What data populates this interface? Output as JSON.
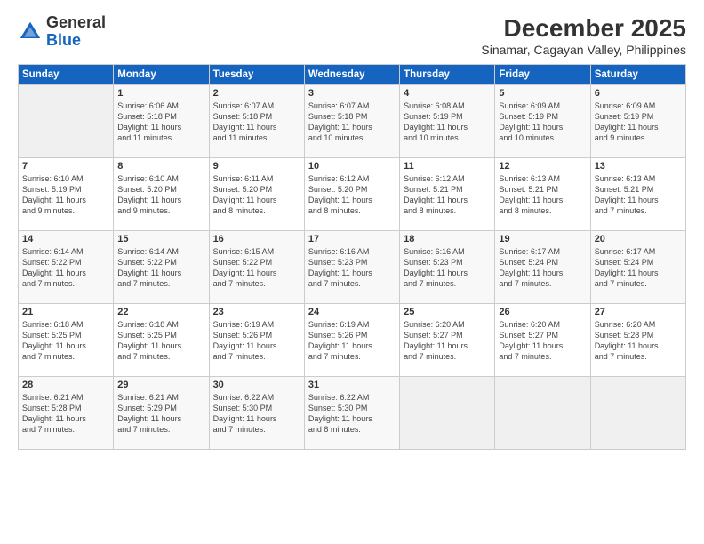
{
  "logo": {
    "general": "General",
    "blue": "Blue"
  },
  "title": "December 2025",
  "subtitle": "Sinamar, Cagayan Valley, Philippines",
  "days_of_week": [
    "Sunday",
    "Monday",
    "Tuesday",
    "Wednesday",
    "Thursday",
    "Friday",
    "Saturday"
  ],
  "weeks": [
    [
      {
        "day": "",
        "info": ""
      },
      {
        "day": "1",
        "info": "Sunrise: 6:06 AM\nSunset: 5:18 PM\nDaylight: 11 hours\nand 11 minutes."
      },
      {
        "day": "2",
        "info": "Sunrise: 6:07 AM\nSunset: 5:18 PM\nDaylight: 11 hours\nand 11 minutes."
      },
      {
        "day": "3",
        "info": "Sunrise: 6:07 AM\nSunset: 5:18 PM\nDaylight: 11 hours\nand 10 minutes."
      },
      {
        "day": "4",
        "info": "Sunrise: 6:08 AM\nSunset: 5:19 PM\nDaylight: 11 hours\nand 10 minutes."
      },
      {
        "day": "5",
        "info": "Sunrise: 6:09 AM\nSunset: 5:19 PM\nDaylight: 11 hours\nand 10 minutes."
      },
      {
        "day": "6",
        "info": "Sunrise: 6:09 AM\nSunset: 5:19 PM\nDaylight: 11 hours\nand 9 minutes."
      }
    ],
    [
      {
        "day": "7",
        "info": "Sunrise: 6:10 AM\nSunset: 5:19 PM\nDaylight: 11 hours\nand 9 minutes."
      },
      {
        "day": "8",
        "info": "Sunrise: 6:10 AM\nSunset: 5:20 PM\nDaylight: 11 hours\nand 9 minutes."
      },
      {
        "day": "9",
        "info": "Sunrise: 6:11 AM\nSunset: 5:20 PM\nDaylight: 11 hours\nand 8 minutes."
      },
      {
        "day": "10",
        "info": "Sunrise: 6:12 AM\nSunset: 5:20 PM\nDaylight: 11 hours\nand 8 minutes."
      },
      {
        "day": "11",
        "info": "Sunrise: 6:12 AM\nSunset: 5:21 PM\nDaylight: 11 hours\nand 8 minutes."
      },
      {
        "day": "12",
        "info": "Sunrise: 6:13 AM\nSunset: 5:21 PM\nDaylight: 11 hours\nand 8 minutes."
      },
      {
        "day": "13",
        "info": "Sunrise: 6:13 AM\nSunset: 5:21 PM\nDaylight: 11 hours\nand 7 minutes."
      }
    ],
    [
      {
        "day": "14",
        "info": "Sunrise: 6:14 AM\nSunset: 5:22 PM\nDaylight: 11 hours\nand 7 minutes."
      },
      {
        "day": "15",
        "info": "Sunrise: 6:14 AM\nSunset: 5:22 PM\nDaylight: 11 hours\nand 7 minutes."
      },
      {
        "day": "16",
        "info": "Sunrise: 6:15 AM\nSunset: 5:22 PM\nDaylight: 11 hours\nand 7 minutes."
      },
      {
        "day": "17",
        "info": "Sunrise: 6:16 AM\nSunset: 5:23 PM\nDaylight: 11 hours\nand 7 minutes."
      },
      {
        "day": "18",
        "info": "Sunrise: 6:16 AM\nSunset: 5:23 PM\nDaylight: 11 hours\nand 7 minutes."
      },
      {
        "day": "19",
        "info": "Sunrise: 6:17 AM\nSunset: 5:24 PM\nDaylight: 11 hours\nand 7 minutes."
      },
      {
        "day": "20",
        "info": "Sunrise: 6:17 AM\nSunset: 5:24 PM\nDaylight: 11 hours\nand 7 minutes."
      }
    ],
    [
      {
        "day": "21",
        "info": "Sunrise: 6:18 AM\nSunset: 5:25 PM\nDaylight: 11 hours\nand 7 minutes."
      },
      {
        "day": "22",
        "info": "Sunrise: 6:18 AM\nSunset: 5:25 PM\nDaylight: 11 hours\nand 7 minutes."
      },
      {
        "day": "23",
        "info": "Sunrise: 6:19 AM\nSunset: 5:26 PM\nDaylight: 11 hours\nand 7 minutes."
      },
      {
        "day": "24",
        "info": "Sunrise: 6:19 AM\nSunset: 5:26 PM\nDaylight: 11 hours\nand 7 minutes."
      },
      {
        "day": "25",
        "info": "Sunrise: 6:20 AM\nSunset: 5:27 PM\nDaylight: 11 hours\nand 7 minutes."
      },
      {
        "day": "26",
        "info": "Sunrise: 6:20 AM\nSunset: 5:27 PM\nDaylight: 11 hours\nand 7 minutes."
      },
      {
        "day": "27",
        "info": "Sunrise: 6:20 AM\nSunset: 5:28 PM\nDaylight: 11 hours\nand 7 minutes."
      }
    ],
    [
      {
        "day": "28",
        "info": "Sunrise: 6:21 AM\nSunset: 5:28 PM\nDaylight: 11 hours\nand 7 minutes."
      },
      {
        "day": "29",
        "info": "Sunrise: 6:21 AM\nSunset: 5:29 PM\nDaylight: 11 hours\nand 7 minutes."
      },
      {
        "day": "30",
        "info": "Sunrise: 6:22 AM\nSunset: 5:30 PM\nDaylight: 11 hours\nand 7 minutes."
      },
      {
        "day": "31",
        "info": "Sunrise: 6:22 AM\nSunset: 5:30 PM\nDaylight: 11 hours\nand 8 minutes."
      },
      {
        "day": "",
        "info": ""
      },
      {
        "day": "",
        "info": ""
      },
      {
        "day": "",
        "info": ""
      }
    ]
  ]
}
